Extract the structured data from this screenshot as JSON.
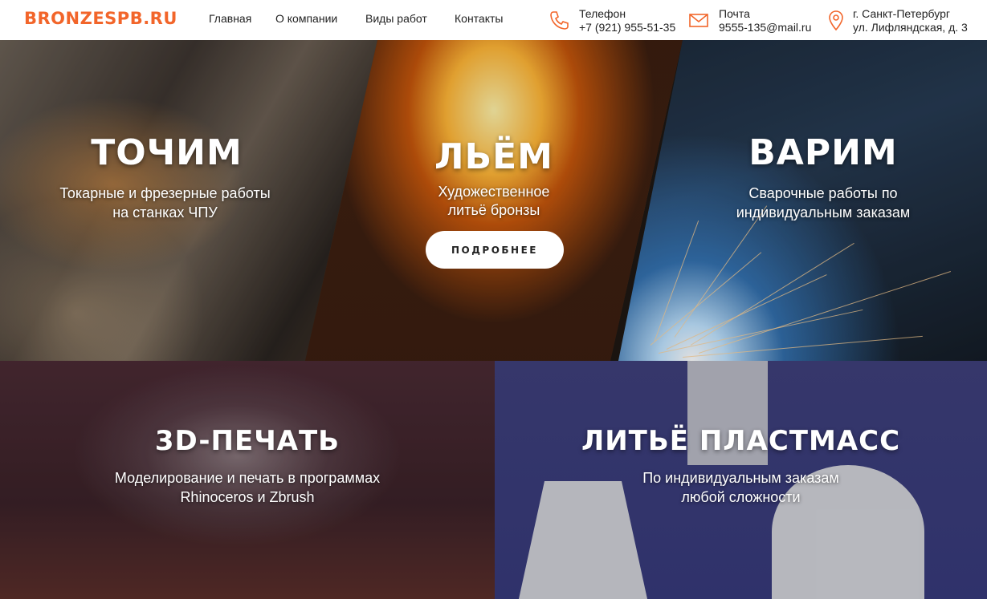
{
  "header": {
    "logo": "BRONZESPB.RU",
    "nav": [
      "Главная",
      "О компании",
      "Виды работ",
      "Контакты"
    ],
    "phone": {
      "label": "Телефон",
      "value": "+7 (921) 955-51-35",
      "icon": "phone-icon"
    },
    "email": {
      "label": "Почта",
      "value": "9555-135@mail.ru",
      "icon": "mail-icon"
    },
    "address": {
      "line1": "г. Санкт-Петербург",
      "line2": "ул. Лифляндская, д. 3",
      "icon": "location-pin-icon"
    }
  },
  "tiles": {
    "turning": {
      "title": "ТОЧИМ",
      "sub1": "Токарные и фрезерные работы",
      "sub2": "на станках ЧПУ"
    },
    "casting": {
      "title": "ЛЬЁМ",
      "sub1": "Художественное",
      "sub2": "литьё бронзы",
      "button": "ПОДРОБНЕЕ"
    },
    "welding": {
      "title": "ВАРИМ",
      "sub1": "Сварочные работы по",
      "sub2": "индивидуальным заказам"
    },
    "printing": {
      "title": "3D-ПЕЧАТЬ",
      "sub1": "Моделирование и печать в программах",
      "sub2": "Rhinoceros и Zbrush"
    },
    "plastic": {
      "title": "ЛИТЬЁ ПЛАСТМАСС",
      "sub1": "По индивидуальным заказам",
      "sub2": "любой сложности"
    }
  },
  "colors": {
    "brand": "#f2652a",
    "header_bg": "#ffffff"
  }
}
